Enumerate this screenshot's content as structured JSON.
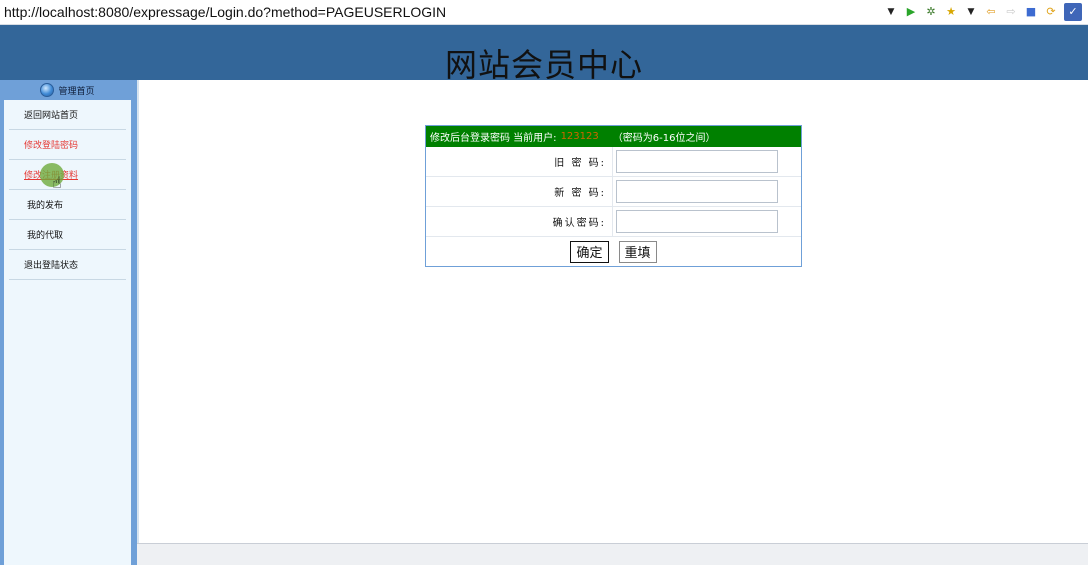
{
  "browser": {
    "url": "http://localhost:8080/expressage/Login.do?method=PAGEUSERLOGIN",
    "icons": [
      "dropdown-arrow-icon",
      "run-icon",
      "debug-icon",
      "favorites-icon",
      "back-icon",
      "forward-icon",
      "stop-icon",
      "refresh-icon",
      "extension-icon"
    ]
  },
  "header": {
    "title": "网站会员中心",
    "bg_color": "#336699"
  },
  "sidebar": {
    "head_label": "管理首页",
    "items": [
      {
        "label": "返回网站首页"
      },
      {
        "label": "修改登陆密码"
      },
      {
        "label": "修改注册资料"
      },
      {
        "label": "我的发布"
      },
      {
        "label": "我的代取"
      },
      {
        "label": "退出登陆状态"
      }
    ]
  },
  "form": {
    "title": "修改后台登录密码 当前用户:",
    "current_user": "123123",
    "hint": "（密码为6-16位之间）",
    "old_label": "旧 密 码:",
    "new_label": "新 密 码:",
    "confirm_label": "确认密码:",
    "submit_label": "确定",
    "reset_label": "重填",
    "header_color": "#008000"
  }
}
